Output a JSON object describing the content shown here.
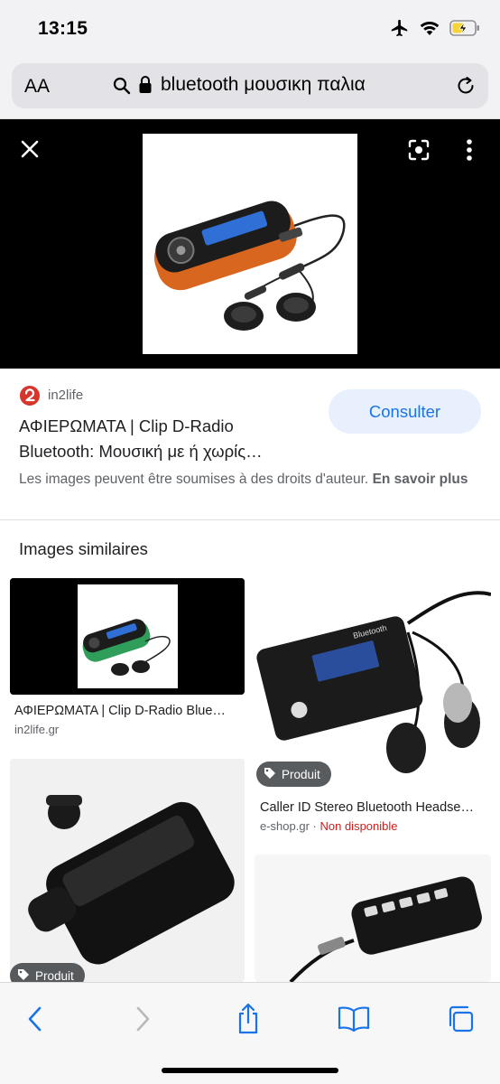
{
  "status": {
    "time": "13:15"
  },
  "browser": {
    "text_size_label": "AA",
    "url": "bluetooth μουσικη παλια"
  },
  "result": {
    "source_name": "in2life",
    "title": "ΑΦΙΕΡΩΜΑΤΑ | Clip D-Radio Bluetooth: Μουσική με ή χωρίς…",
    "visit_button": "Consulter",
    "rights_text": "Les images peuvent être soumises à des droits d'auteur.",
    "rights_link": "En savoir plus"
  },
  "similar": {
    "heading": "Images similaires",
    "items": [
      {
        "title": "ΑΦΙΕΡΩΜΑΤΑ | Clip D-Radio Blue…",
        "source": "in2life.gr"
      },
      {
        "title": "Caller ID Stereo Bluetooth Headse…",
        "source": "e-shop.gr",
        "separator": " · ",
        "availability": "Non disponible",
        "badge": "Produit"
      },
      {
        "badge": "Produit"
      },
      {
        "screen_text": "Bluetooth"
      }
    ]
  },
  "icons": [
    "airplane-icon",
    "wifi-icon",
    "battery-charging-icon",
    "search-icon",
    "lock-icon",
    "reload-icon",
    "close-icon",
    "lens-icon",
    "more-vert-icon",
    "tag-icon",
    "back-icon",
    "forward-icon",
    "share-icon",
    "bookmarks-icon",
    "tabs-icon"
  ],
  "colors": {
    "accent": "#1a73e8",
    "button_bg": "#e8f0fe",
    "unavailable": "#c5221f",
    "battery": "#f5d33a"
  }
}
